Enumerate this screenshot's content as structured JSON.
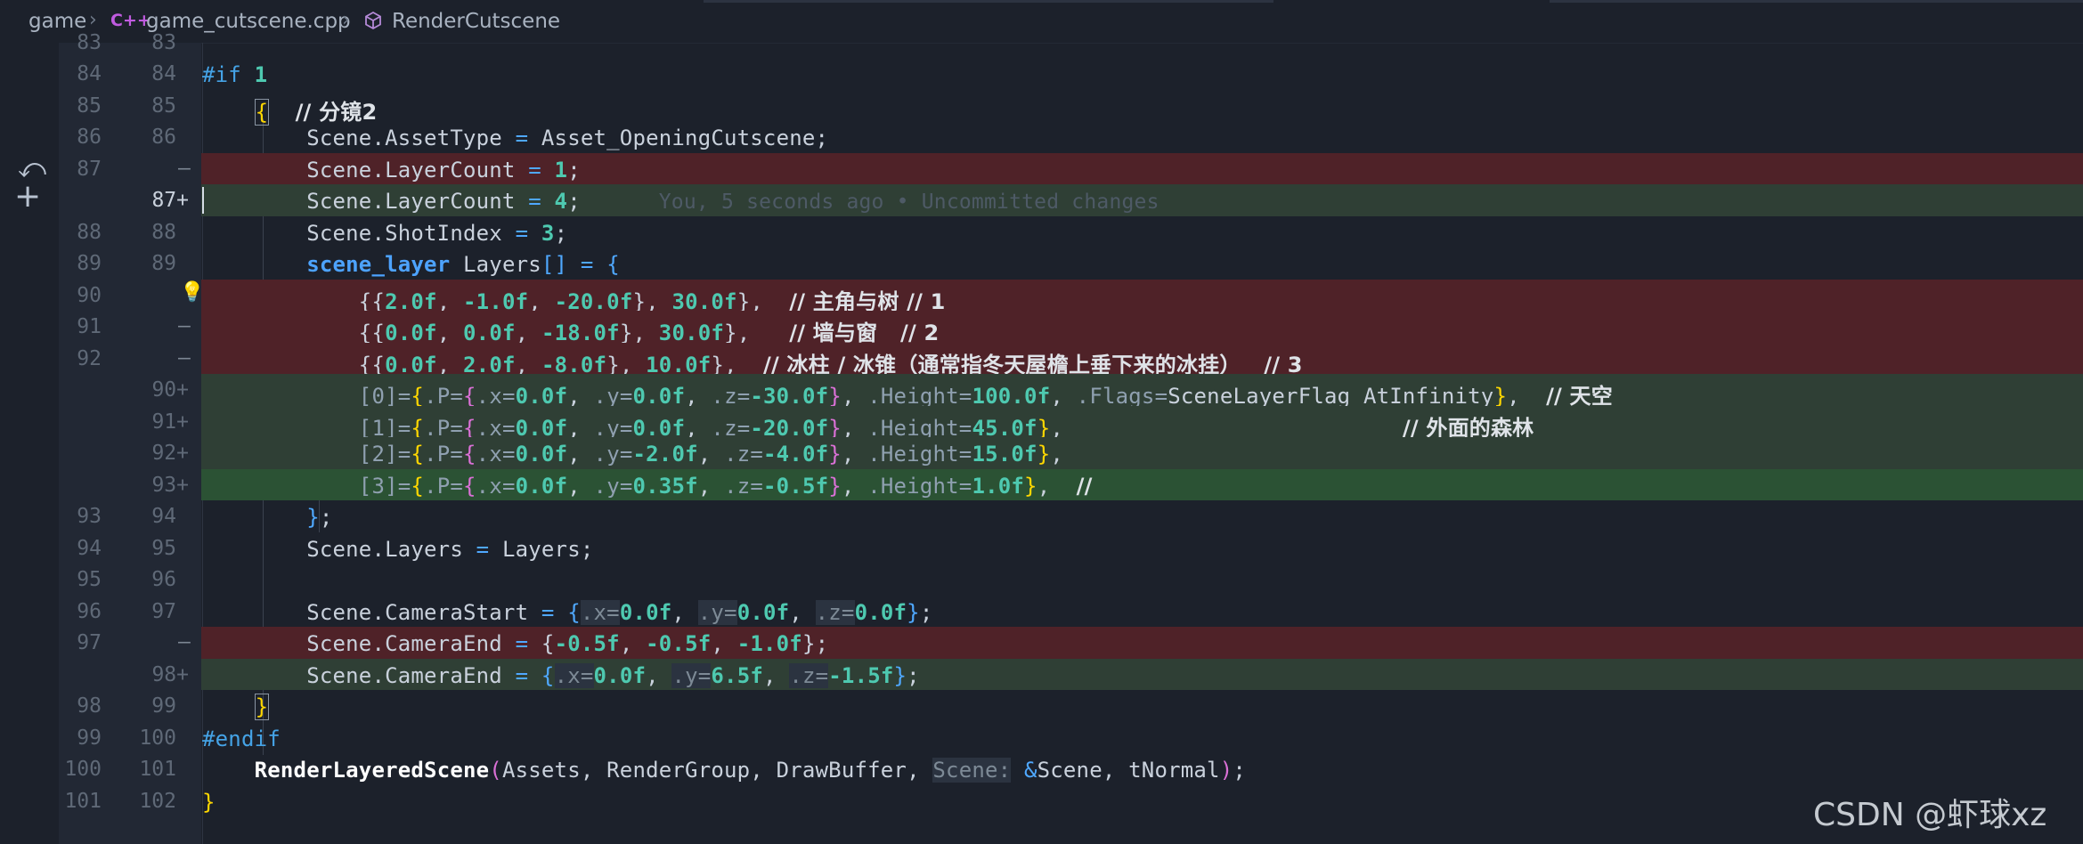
{
  "breadcrumb": {
    "folder": "game",
    "file": "game_cutscene.cpp",
    "file_icon": "C++",
    "symbol": "RenderCutscene"
  },
  "blame_hint": "You, 5 seconds ago • Uncommitted changes",
  "lines": [
    {
      "old": "83",
      "new": "83",
      "type": "ctx",
      "text": ""
    },
    {
      "old": "84",
      "new": "84",
      "type": "ctx",
      "text": "#if 1"
    },
    {
      "old": "85",
      "new": "85",
      "type": "ctx",
      "text": "    {  // 分镜2"
    },
    {
      "old": "86",
      "new": "86",
      "type": "ctx",
      "text": "        Scene.AssetType = Asset_OpeningCutscene;"
    },
    {
      "old": "87",
      "new": "—",
      "type": "del",
      "text": "        Scene.LayerCount = 1;"
    },
    {
      "old": "",
      "new": "87+",
      "type": "add",
      "text": "        Scene.LayerCount = 4;"
    },
    {
      "old": "88",
      "new": "88",
      "type": "ctx",
      "text": "        Scene.ShotIndex = 3;"
    },
    {
      "old": "89",
      "new": "89",
      "type": "ctx",
      "text": "        scene_layer Layers[] = {"
    },
    {
      "old": "90",
      "new": "",
      "type": "del",
      "text": "            {{2.0f, -1.0f, -20.0f}, 30.0f},  // 主角与树 // 1"
    },
    {
      "old": "91",
      "new": "—",
      "type": "del",
      "text": "            {{0.0f, 0.0f, -18.0f}, 30.0f},   // 墙与窗   // 2"
    },
    {
      "old": "92",
      "new": "—",
      "type": "del",
      "text": "            {{0.0f, 2.0f, -8.0f}, 10.0f},  // 冰柱 / 冰锥（通常指冬天屋檐上垂下来的冰挂）   // 3"
    },
    {
      "old": "",
      "new": "90+",
      "type": "add",
      "text": "            [0]={.P={.x=0.0f, .y=0.0f, .z=-30.0f}, .Height=100.0f, .Flags=SceneLayerFlag_AtInfinity},  // 天空"
    },
    {
      "old": "",
      "new": "91+",
      "type": "add",
      "text": "            [1]={.P={.x=0.0f, .y=0.0f, .z=-20.0f}, .Height=45.0f},                          // 外面的森林"
    },
    {
      "old": "",
      "new": "92+",
      "type": "add",
      "text": "            [2]={.P={.x=0.0f, .y=-2.0f, .z=-4.0f}, .Height=15.0f},"
    },
    {
      "old": "",
      "new": "93+",
      "type": "add",
      "text": "            [3]={.P={.x=0.0f, .y=0.35f, .z=-0.5f}, .Height=1.0f},  //"
    },
    {
      "old": "93",
      "new": "94",
      "type": "ctx",
      "text": "        };"
    },
    {
      "old": "94",
      "new": "95",
      "type": "ctx",
      "text": "        Scene.Layers = Layers;"
    },
    {
      "old": "95",
      "new": "96",
      "type": "ctx",
      "text": ""
    },
    {
      "old": "96",
      "new": "97",
      "type": "ctx",
      "text": "        Scene.CameraStart = {.x=0.0f, .y=0.0f, .z=0.0f};"
    },
    {
      "old": "97",
      "new": "—",
      "type": "del",
      "text": "        Scene.CameraEnd = {-0.5f, -0.5f, -1.0f};"
    },
    {
      "old": "",
      "new": "98+",
      "type": "add",
      "text": "        Scene.CameraEnd = {.x=0.0f, .y=6.5f, .z=-1.5f};"
    },
    {
      "old": "98",
      "new": "99",
      "type": "ctx",
      "text": "    }"
    },
    {
      "old": "99",
      "new": "100",
      "type": "ctx",
      "text": "#endif"
    },
    {
      "old": "100",
      "new": "101",
      "type": "ctx",
      "text": "    RenderLayeredScene(Assets, RenderGroup, DrawBuffer, Scene: &Scene, tNormal);"
    },
    {
      "old": "101",
      "new": "102",
      "type": "ctx",
      "text": "}"
    }
  ],
  "gutter_icons": {
    "revert": "revert-icon",
    "stage": "plus-icon",
    "bulb": "lightbulb-icon"
  },
  "watermark": "CSDN @虾球xz"
}
